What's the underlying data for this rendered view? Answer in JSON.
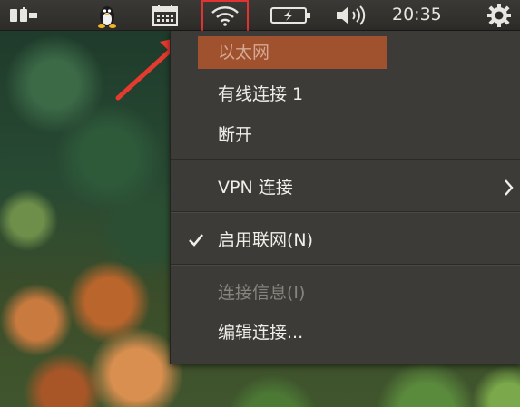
{
  "panel": {
    "time": "20:35",
    "icons": [
      "keyboard-input-icon",
      "tux-icon",
      "calendar-icon",
      "wifi-icon",
      "battery-icon",
      "volume-icon",
      "power-gear-icon"
    ]
  },
  "menu": {
    "header": "以太网",
    "items": [
      {
        "label": "有线连接 1",
        "enabled": true
      },
      {
        "label": "断开",
        "enabled": true
      },
      {
        "label": "VPN 连接",
        "enabled": true,
        "submenu": true
      },
      {
        "label": "启用联网(N)",
        "enabled": true,
        "checked": true
      },
      {
        "label": "连接信息(I)",
        "enabled": false
      },
      {
        "label": "编辑连接...",
        "enabled": true
      }
    ]
  },
  "colors": {
    "panel": "#2d2c29",
    "menu": "#3c3b37",
    "selected": "#a0512e",
    "annotation": "#e23333"
  }
}
